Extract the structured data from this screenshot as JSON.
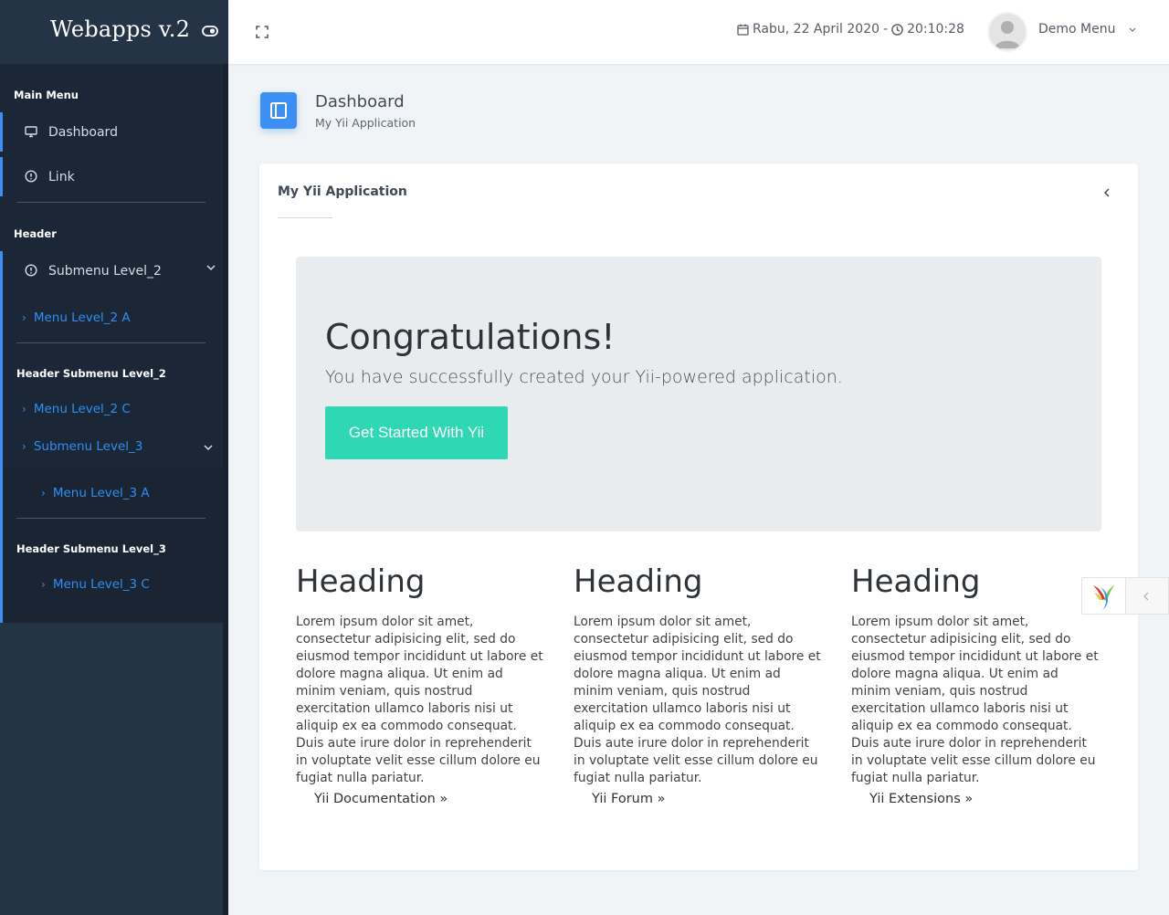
{
  "app": {
    "logo": "Webapps v.2"
  },
  "sidebar": {
    "header_main": "Main Menu",
    "item_dashboard": "Dashboard",
    "item_link": "Link",
    "header_header": "Header",
    "item_submenu2": "Submenu Level_2",
    "item_menu2a": "Menu Level_2 A",
    "header_sub2": "Header Submenu Level_2",
    "item_menu2c": "Menu Level_2 C",
    "item_submenu3": "Submenu Level_3",
    "item_menu3a": "Menu Level_3 A",
    "header_sub3": "Header Submenu Level_3",
    "item_menu3c": "Menu Level_3 C"
  },
  "topbar": {
    "date": "Rabu, 22 April 2020",
    "separator": "-",
    "time": "20:10:28",
    "user_name": "Demo Menu"
  },
  "page": {
    "title": "Dashboard",
    "subtitle": "My Yii Application"
  },
  "card": {
    "title": "My Yii Application",
    "jumbotron": {
      "title": "Congratulations!",
      "lead": "You have successfully created your Yii-powered application.",
      "button": "Get Started With Yii"
    },
    "columns": [
      {
        "heading": "Heading",
        "body": "Lorem ipsum dolor sit amet, consectetur adipisicing elit, sed do eiusmod tempor incididunt ut labore et dolore magna aliqua. Ut enim ad minim veniam, quis nostrud exercitation ullamco laboris nisi ut aliquip ex ea commodo consequat. Duis aute irure dolor in reprehenderit in voluptate velit esse cillum dolore eu fugiat nulla pariatur.",
        "link": "Yii Documentation »"
      },
      {
        "heading": "Heading",
        "body": "Lorem ipsum dolor sit amet, consectetur adipisicing elit, sed do eiusmod tempor incididunt ut labore et dolore magna aliqua. Ut enim ad minim veniam, quis nostrud exercitation ullamco laboris nisi ut aliquip ex ea commodo consequat. Duis aute irure dolor in reprehenderit in voluptate velit esse cillum dolore eu fugiat nulla pariatur.",
        "link": "Yii Forum »"
      },
      {
        "heading": "Heading",
        "body": "Lorem ipsum dolor sit amet, consectetur adipisicing elit, sed do eiusmod tempor incididunt ut labore et dolore magna aliqua. Ut enim ad minim veniam, quis nostrud exercitation ullamco laboris nisi ut aliquip ex ea commodo consequat. Duis aute irure dolor in reprehenderit in voluptate velit esse cillum dolore eu fugiat nulla pariatur.",
        "link": "Yii Extensions »"
      }
    ]
  },
  "colors": {
    "sidebar_bg": "#253346",
    "sidebar_panel": "#1b2637",
    "accent_blue": "#3b8ff5",
    "link_blue": "#2f8ff2",
    "button_teal": "#2fd8b5",
    "page_bg": "#f1f4f6"
  },
  "icons": {
    "toggle": "eye-toggle-icon",
    "fullscreen": "fullscreen-icon",
    "calendar": "calendar-icon",
    "clock": "clock-icon",
    "dashboard": "monitor-icon",
    "link": "alert-circle-icon",
    "page": "layout-sidebar-icon",
    "debug": "yii-logo-icon"
  }
}
